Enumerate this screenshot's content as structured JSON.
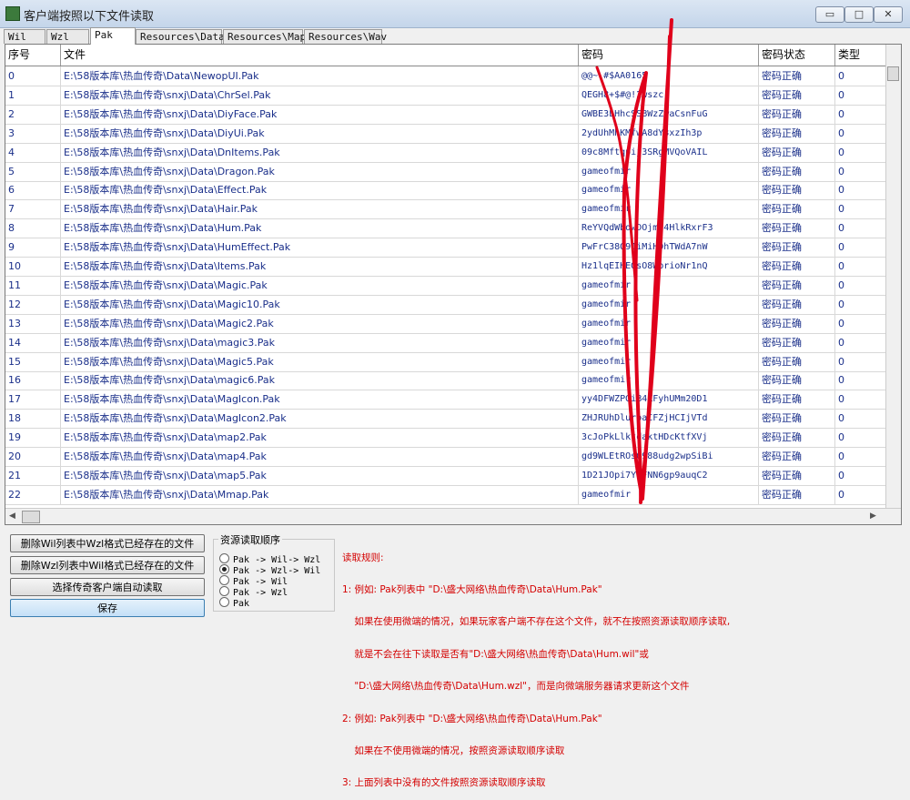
{
  "window": {
    "title": "客户端按照以下文件读取",
    "min_label": "▭",
    "max_label": "□",
    "close_label": "✕"
  },
  "tabs": [
    "Wil",
    "Wzl",
    "Pak",
    "Resources\\Data",
    "Resources\\Map",
    "Resources\\Wav"
  ],
  "table": {
    "headers": [
      "序号",
      "文件",
      "密码",
      "密码状态",
      "类型"
    ],
    "rows": [
      [
        "0",
        "E:\\58版本库\\热血传奇\\Data\\NewopUI.Pak",
        "@@~ #$AA0165",
        "密码正确",
        "0"
      ],
      [
        "1",
        "E:\\58版本库\\热血传奇\\snxj\\Data\\ChrSel.Pak",
        "QEGH8+$#@!2wszc",
        "密码正确",
        "0"
      ],
      [
        "2",
        "E:\\58版本库\\热血传奇\\snxj\\Data\\DiyFace.Pak",
        "GWBE3LHhcSSBWzZwaCsnFuG",
        "密码正确",
        "0"
      ],
      [
        "3",
        "E:\\58版本库\\热血传奇\\snxj\\Data\\DiyUi.Pak",
        "2ydUhMhKMfwA8dY3xzIh3p",
        "密码正确",
        "0"
      ],
      [
        "4",
        "E:\\58版本库\\热血传奇\\snxj\\Data\\DnItems.Pak",
        "09c8Mftqpij3SRgMVQoVAIL",
        "密码正确",
        "0"
      ],
      [
        "5",
        "E:\\58版本库\\热血传奇\\snxj\\Data\\Dragon.Pak",
        "gameofmir",
        "密码正确",
        "0"
      ],
      [
        "6",
        "E:\\58版本库\\热血传奇\\snxj\\Data\\Effect.Pak",
        "gameofmir",
        "密码正确",
        "0"
      ],
      [
        "7",
        "E:\\58版本库\\热血传奇\\snxj\\Data\\Hair.Pak",
        "gameofmir",
        "密码正确",
        "0"
      ],
      [
        "8",
        "E:\\58版本库\\热血传奇\\snxj\\Data\\Hum.Pak",
        "ReYVQdWbowDOjmI4HlkRxrF3",
        "密码正确",
        "0"
      ],
      [
        "9",
        "E:\\58版本库\\热血传奇\\snxj\\Data\\HumEffect.Pak",
        "PwFrC38G9IiMiHDhTWdA7nW",
        "密码正确",
        "0"
      ],
      [
        "10",
        "E:\\58版本库\\热血传奇\\snxj\\Data\\Items.Pak",
        "Hz1lqEIHEGsO8WbrioNr1nQ",
        "密码正确",
        "0"
      ],
      [
        "11",
        "E:\\58版本库\\热血传奇\\snxj\\Data\\Magic.Pak",
        "gameofmir",
        "密码正确",
        "0"
      ],
      [
        "12",
        "E:\\58版本库\\热血传奇\\snxj\\Data\\Magic10.Pak",
        "gameofmir",
        "密码正确",
        "0"
      ],
      [
        "13",
        "E:\\58版本库\\热血传奇\\snxj\\Data\\Magic2.Pak",
        "gameofmir",
        "密码正确",
        "0"
      ],
      [
        "14",
        "E:\\58版本库\\热血传奇\\snxj\\Data\\magic3.Pak",
        "gameofmir",
        "密码正确",
        "0"
      ],
      [
        "15",
        "E:\\58版本库\\热血传奇\\snxj\\Data\\Magic5.Pak",
        "gameofmir",
        "密码正确",
        "0"
      ],
      [
        "16",
        "E:\\58版本库\\热血传奇\\snxj\\Data\\magic6.Pak",
        "gameofmir",
        "密码正确",
        "0"
      ],
      [
        "17",
        "E:\\58版本库\\热血传奇\\snxj\\Data\\MagIcon.Pak",
        "yy4DFWZPGiB4ZFyhUMm20D1",
        "密码正确",
        "0"
      ],
      [
        "18",
        "E:\\58版本库\\热血传奇\\snxj\\Data\\MagIcon2.Pak",
        "ZHJRUhDluroaCFZjHCIjVTd",
        "密码正确",
        "0"
      ],
      [
        "19",
        "E:\\58版本库\\热血传奇\\snxj\\Data\\map2.Pak",
        "3cJoPkLlktdaktHDcKtfXVj",
        "密码正确",
        "0"
      ],
      [
        "20",
        "E:\\58版本库\\热血传奇\\snxj\\Data\\map4.Pak",
        "gd9WLEtROs0988udg2wpSiBi",
        "密码正确",
        "0"
      ],
      [
        "21",
        "E:\\58版本库\\热血传奇\\snxj\\Data\\map5.Pak",
        "1D21JOpi7YcFNN6gp9auqC2",
        "密码正确",
        "0"
      ],
      [
        "22",
        "E:\\58版本库\\热血传奇\\snxj\\Data\\Mmap.Pak",
        "gameofmir",
        "密码正确",
        "0"
      ]
    ]
  },
  "buttons": {
    "delete_wil": "删除Wil列表中Wzl格式已经存在的文件",
    "delete_wzl": "删除Wzl列表中Wil格式已经存在的文件",
    "auto_read": "选择传奇客户端自动读取",
    "save": "保存"
  },
  "resource_order": {
    "title": "资源读取顺序",
    "options": [
      {
        "label": "Pak -> Wil-> Wzl",
        "selected": false
      },
      {
        "label": "Pak -> Wzl-> Wil",
        "selected": true
      },
      {
        "label": "Pak -> Wil",
        "selected": false
      },
      {
        "label": "Pak -> Wzl",
        "selected": false
      },
      {
        "label": "Pak",
        "selected": false
      }
    ]
  },
  "rules": {
    "lines": [
      "读取规则:",
      "1: 例如: Pak列表中 \"D:\\盛大网络\\热血传奇\\Data\\Hum.Pak\"",
      "    如果在使用微端的情况，如果玩家客户端不存在这个文件，就不在按照资源读取顺序读取,",
      "    就是不会在往下读取是否有\"D:\\盛大网络\\热血传奇\\Data\\Hum.wil\"或",
      "    \"D:\\盛大网络\\热血传奇\\Data\\Hum.wzl\"，而是向微端服务器请求更新这个文件",
      "2: 例如: Pak列表中 \"D:\\盛大网络\\热血传奇\\Data\\Hum.Pak\"",
      "    如果在不使用微端的情况，按照资源读取顺序读取",
      "3: 上面列表中没有的文件按照资源读取顺序读取"
    ]
  },
  "colors": {
    "link_text": "#1a2f8a",
    "rule_text": "#d40000",
    "scribble": "#e0001b"
  }
}
